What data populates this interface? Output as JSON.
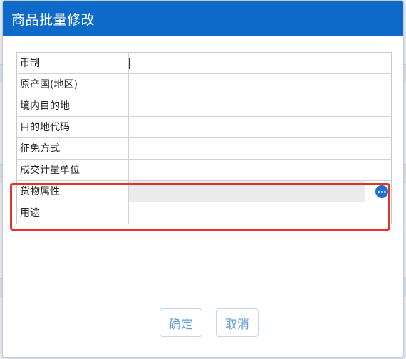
{
  "dialog": {
    "title": "商品批量修改",
    "fields": [
      {
        "label": "币制",
        "value": ""
      },
      {
        "label": "原产国(地区)",
        "value": ""
      },
      {
        "label": "境内目的地",
        "value": ""
      },
      {
        "label": "目的地代码",
        "value": ""
      },
      {
        "label": "征免方式",
        "value": ""
      },
      {
        "label": "成交计量单位",
        "value": ""
      },
      {
        "label": "货物属性",
        "value": ""
      },
      {
        "label": "用途",
        "value": ""
      }
    ],
    "buttons": {
      "ok": "确定",
      "cancel": "取消"
    }
  },
  "colors": {
    "header": "#0d6ac9",
    "highlight": "#e6312a",
    "button_text": "#6aa0d8",
    "more_icon": "#1d6fd1"
  },
  "icons": {
    "more": "ellipsis-circle-icon"
  }
}
